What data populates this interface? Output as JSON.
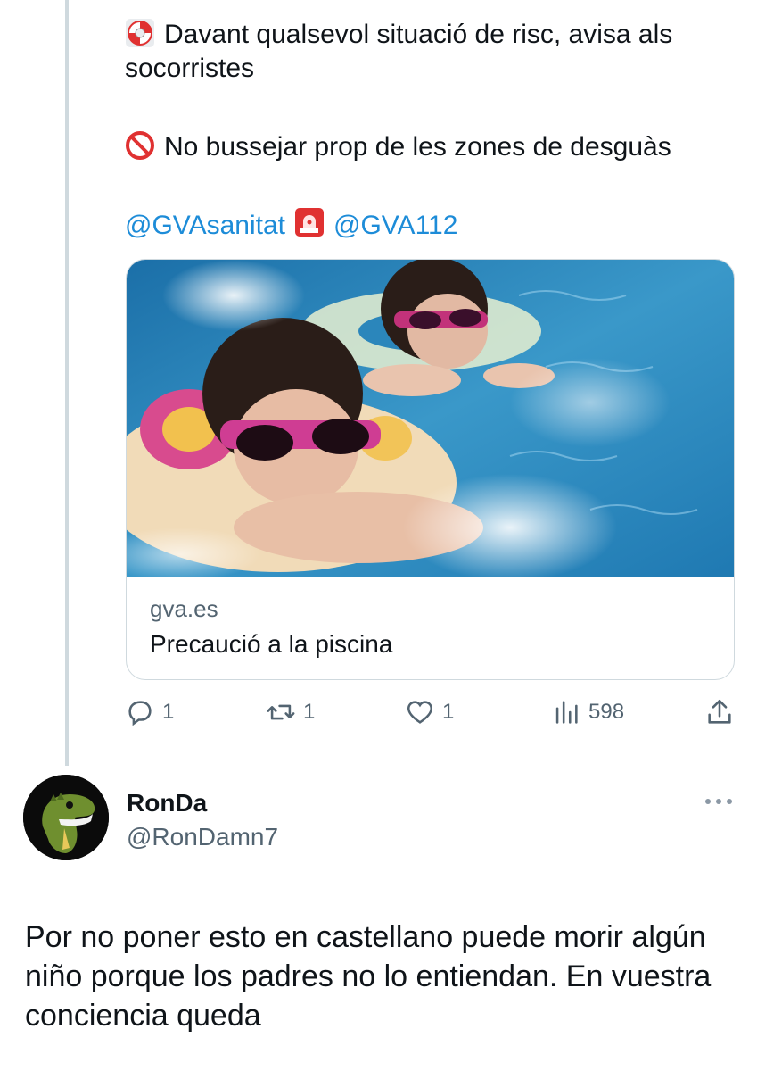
{
  "tweet": {
    "line1_text": "Davant qualsevol situació de risc, avisa als socorristes",
    "line2_text": "No bussejar prop de les zones de desguàs",
    "mention1": "@GVAsanitat",
    "mention2": "@GVA112",
    "card": {
      "domain": "gva.es",
      "title": "Precaució a la piscina"
    },
    "stats": {
      "replies": "1",
      "retweets": "1",
      "likes": "1",
      "views": "598"
    }
  },
  "reply": {
    "name": "RonDa",
    "handle": "@RonDamn7",
    "text": "Por no poner esto en castellano puede morir algún niño porque los padres no lo entiendan. En vuestra conciencia queda"
  },
  "colors": {
    "link": "#1d8cd8",
    "muted": "#536471",
    "text": "#0f1419",
    "border": "#cfd9de"
  },
  "icons": [
    "lifebuoy-icon",
    "prohibited-icon",
    "rotating-light-icon",
    "reply-icon",
    "retweet-icon",
    "like-icon",
    "views-icon",
    "share-icon",
    "more-icon"
  ]
}
